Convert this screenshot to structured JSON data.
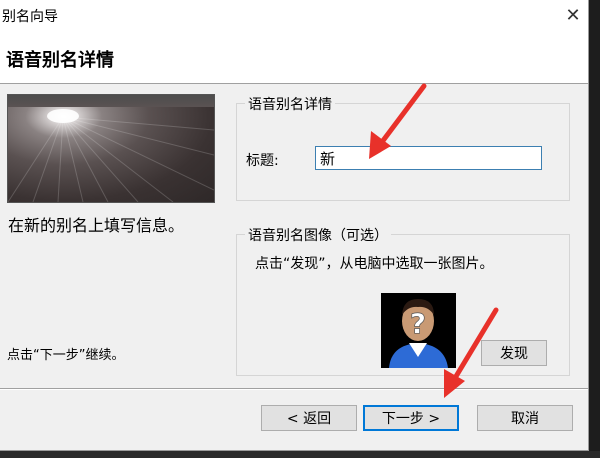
{
  "window": {
    "title": "别名向导",
    "close_glyph": "✕"
  },
  "header": {
    "title": "语音别名详情"
  },
  "left": {
    "intro": "在新的别名上填写信息。",
    "hint": "点击“下一步”继续。"
  },
  "details_group": {
    "legend": "语音别名详情",
    "title_label": "标题:",
    "title_value": "新"
  },
  "image_group": {
    "legend": "语音别名图像（可选）",
    "description": "点击“发现”，从电脑中选取一张图片。",
    "browse_button": "发现"
  },
  "footer": {
    "back_button": "< 返回",
    "next_button": "下一步 >",
    "cancel_button": "取消"
  },
  "colors": {
    "annotation_arrow": "#e8312a",
    "focus_border": "#0078d7"
  },
  "icons": [
    "close-icon",
    "question-person-icon",
    "red-arrow-annotation"
  ]
}
